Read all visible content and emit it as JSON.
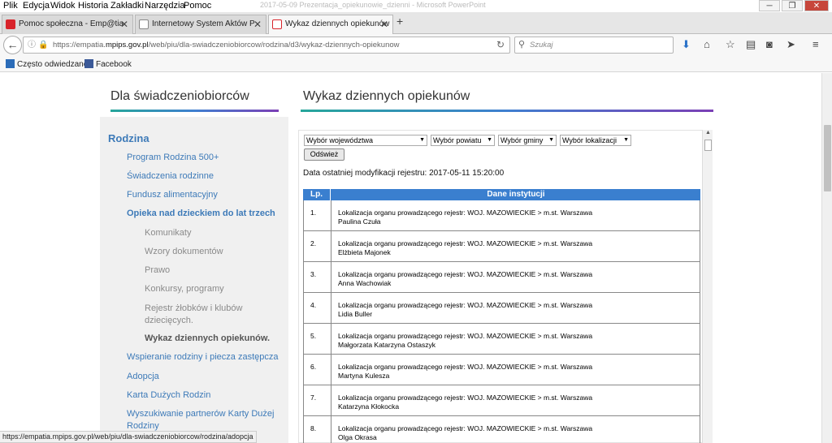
{
  "menubar": {
    "items": [
      "Plik",
      "Edycja",
      "Widok",
      "Historia",
      "Zakładki",
      "Narzędzia",
      "Pomoc"
    ],
    "window_title": "2017-05-09 Prezentacja_opiekunowie_dzienni - Microsoft PowerPoint"
  },
  "tabs": [
    {
      "title": "Pomoc społeczna - Emp@tia"
    },
    {
      "title": "Internetowy System Aktów P"
    },
    {
      "title": "Wykaz dziennych opiekunów"
    }
  ],
  "address": {
    "url_prefix": "https://empatia.",
    "url_domain": "mpips.gov.pl",
    "url_path": "/web/piu/dla-swiadczeniobiorcow/rodzina/d3/wykaz-dziennych-opiekunow",
    "search_placeholder": "Szukaj"
  },
  "bookmarks": [
    "Często odwiedzane",
    "Facebook"
  ],
  "sidebar": {
    "heading": "Dla świadczeniobiorców",
    "section": "Rodzina",
    "items": [
      "Program Rodzina 500+",
      "Świadczenia rodzinne",
      "Fundusz alimentacyjny",
      "Opieka nad dzieckiem do lat trzech"
    ],
    "subitems": [
      "Komunikaty",
      "Wzory dokumentów",
      "Prawo",
      "Konkursy, programy",
      "Rejestr żłobków i klubów",
      "dziecięcych.",
      "Wykaz dziennych opiekunów."
    ],
    "items2": [
      "Wspieranie rodziny i piecza zastępcza",
      "Adopcja",
      "Karta Dużych Rodzin",
      "Wyszukiwanie partnerów Karty Dużej",
      "Rodziny"
    ]
  },
  "main": {
    "heading": "Wykaz dziennych opiekunów",
    "filters": [
      "Wybór województwa",
      "Wybór powiatu",
      "Wybór gminy",
      "Wybór lokalizacji"
    ],
    "refresh_label": "Odśwież",
    "modified": "Data ostatniej modyfikacji rejestru: 2017-05-11 15:20:00",
    "table": {
      "headers": [
        "Lp.",
        "Dane instytucji"
      ],
      "rows": [
        {
          "lp": "1.",
          "loc": "Lokalizacja organu prowadzącego rejestr: WOJ. MAZOWIECKIE > m.st. Warszawa",
          "name": "Paulina Czuła"
        },
        {
          "lp": "2.",
          "loc": "Lokalizacja organu prowadzącego rejestr: WOJ. MAZOWIECKIE > m.st. Warszawa",
          "name": "Elżbieta Majonek"
        },
        {
          "lp": "3.",
          "loc": "Lokalizacja organu prowadzącego rejestr: WOJ. MAZOWIECKIE > m.st. Warszawa",
          "name": "Anna Wachowiak"
        },
        {
          "lp": "4.",
          "loc": "Lokalizacja organu prowadzącego rejestr: WOJ. MAZOWIECKIE > m.st. Warszawa",
          "name": "Lidia Buller"
        },
        {
          "lp": "5.",
          "loc": "Lokalizacja organu prowadzącego rejestr: WOJ. MAZOWIECKIE > m.st. Warszawa",
          "name": "Małgorzata Katarzyna Ostaszyk"
        },
        {
          "lp": "6.",
          "loc": "Lokalizacja organu prowadzącego rejestr: WOJ. MAZOWIECKIE > m.st. Warszawa",
          "name": "Martyna Kulesza"
        },
        {
          "lp": "7.",
          "loc": "Lokalizacja organu prowadzącego rejestr: WOJ. MAZOWIECKIE > m.st. Warszawa",
          "name": "Katarzyna Kłokocka"
        },
        {
          "lp": "8.",
          "loc": "Lokalizacja organu prowadzącego rejestr: WOJ. MAZOWIECKIE > m.st. Warszawa",
          "name": "Olga Okrasa"
        }
      ]
    }
  },
  "status": {
    "link": "https://empatia.mpips.gov.pl/web/piu/dla-swiadczeniobiorcow/rodzina/adopcja"
  }
}
